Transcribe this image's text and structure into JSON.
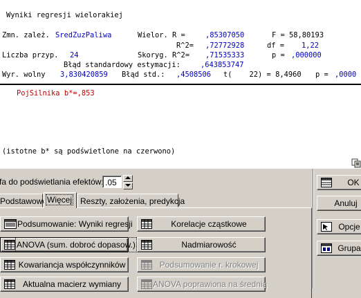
{
  "output": {
    "title": "Wyniki regresji wielorakiej",
    "row1": {
      "zmn_label": "Zmn. zależ.",
      "zmn_value": "SredZuzPaliwa",
      "wielor_label": "Wielor. R =",
      "wielor_value": ",85307050",
      "f_label": "F = 58,80193"
    },
    "row2": {
      "r2_label": "R^2=",
      "r2_value": ",72772928",
      "df_label": "df =",
      "df_value": "1,22"
    },
    "row3": {
      "n_label": "Liczba przyp.",
      "n_value": "24",
      "skor_label": "Skoryg. R^2=",
      "skor_value": ",71535333",
      "p_label": "p =",
      "p_value": ",000000"
    },
    "row4": {
      "text": "Błąd standardowy estymacji:",
      "value": ",643853747"
    },
    "row5": {
      "label": "Wyr. wolny",
      "value": "3,830420859",
      "bs_label": "Błąd std.:",
      "bs_value": ",4508506",
      "t_label": "t(    22) = 8,4960",
      "p_label": "p =",
      "p_value": ",0000"
    },
    "highlight": "PojSilnika b*=,853",
    "note": "(istotne b* są podświetlone na czerwono)"
  },
  "dialog": {
    "alpha_label": "fa do podświetlania efektów:",
    "alpha_value": ".05",
    "tabs": [
      "Podstawowe",
      "Więcej",
      "Reszty, założenia, predykcja"
    ],
    "buttons_left": [
      {
        "label": "Podsumowanie:  Wyniki regresji",
        "icon": "summary-sheet-icon",
        "disabled": false
      },
      {
        "label": "ANOVA (sum. dobroć dopasow.)",
        "icon": "table-grid-icon",
        "disabled": false
      },
      {
        "label": "Kowariancja współczynników",
        "icon": "table-grid-icon",
        "disabled": false
      },
      {
        "label": "Aktualna macierz wymiany",
        "icon": "table-grid-icon",
        "disabled": false
      }
    ],
    "buttons_right": [
      {
        "label": "Korelacje cząstkowe",
        "icon": "table-grid-icon",
        "disabled": false
      },
      {
        "label": "Nadmiarowość",
        "icon": "table-grid-icon",
        "disabled": false
      },
      {
        "label": "Podsumowanie r. krokowej",
        "icon": "table-grid-icon",
        "disabled": true
      },
      {
        "label": "ANOVA poprawiona na średnią",
        "icon": "table-grid-icon",
        "disabled": true
      }
    ],
    "side": {
      "ok": "OK",
      "cancel": "Anuluj",
      "options": "Opcje",
      "group": "Grupar"
    }
  }
}
